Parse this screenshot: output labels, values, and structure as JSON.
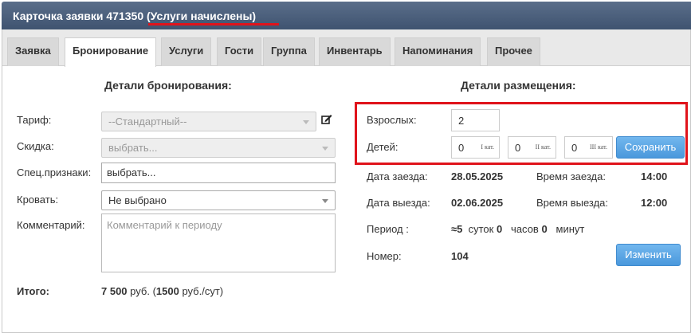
{
  "title": {
    "prefix": "Карточка заявки 471350",
    "status": "(Услуги начислены)"
  },
  "tabs": [
    {
      "label": "Заявка",
      "active": false
    },
    {
      "label": "Бронирование",
      "active": true
    },
    {
      "label": "Услуги",
      "active": false
    },
    {
      "label": "Гости",
      "active": false
    },
    {
      "label": "Группа",
      "active": false
    },
    {
      "label": "Инвентарь",
      "active": false
    },
    {
      "label": "Напоминания",
      "active": false
    },
    {
      "label": "Прочее",
      "active": false
    }
  ],
  "booking": {
    "heading": "Детали бронирования:",
    "tariff_label": "Тариф:",
    "tariff_value": "--Стандартный--",
    "discount_label": "Скидка:",
    "discount_value": "выбрать...",
    "special_label": "Спец.признаки:",
    "special_value": "выбрать...",
    "bed_label": "Кровать:",
    "bed_value": "Не выбрано",
    "comment_label": "Комментарий:",
    "comment_placeholder": "Комментарий к периоду",
    "total_label": "Итого:",
    "total_amount": "7 500",
    "total_currency": "руб. (",
    "daily_amount": "1500",
    "daily_unit": "руб./сут)"
  },
  "placement": {
    "heading": "Детали размещения:",
    "adults_label": "Взрослых:",
    "adults_value": "2",
    "children_label": "Детей:",
    "children": [
      {
        "value": "0",
        "cat": "I кат."
      },
      {
        "value": "0",
        "cat": "II кат."
      },
      {
        "value": "0",
        "cat": "III кат."
      }
    ],
    "save_label": "Сохранить",
    "checkin_date_label": "Дата заезда:",
    "checkin_date": "28.05.2025",
    "checkin_time_label": "Время заезда:",
    "checkin_time": "14:00",
    "checkout_date_label": "Дата выезда:",
    "checkout_date": "02.06.2025",
    "checkout_time_label": "Время выезда:",
    "checkout_time": "12:00",
    "period_label": "Период :",
    "period_days": "≈5",
    "period_days_unit": "суток",
    "period_hours": "0",
    "period_hours_unit": "часов",
    "period_minutes": "0",
    "period_minutes_unit": "минут",
    "room_label": "Номер:",
    "room_value": "104",
    "change_label": "Изменить"
  },
  "colors": {
    "accent_red": "#e0131b",
    "button_blue": "#4a98dc",
    "titlebar": "#3f5370"
  }
}
